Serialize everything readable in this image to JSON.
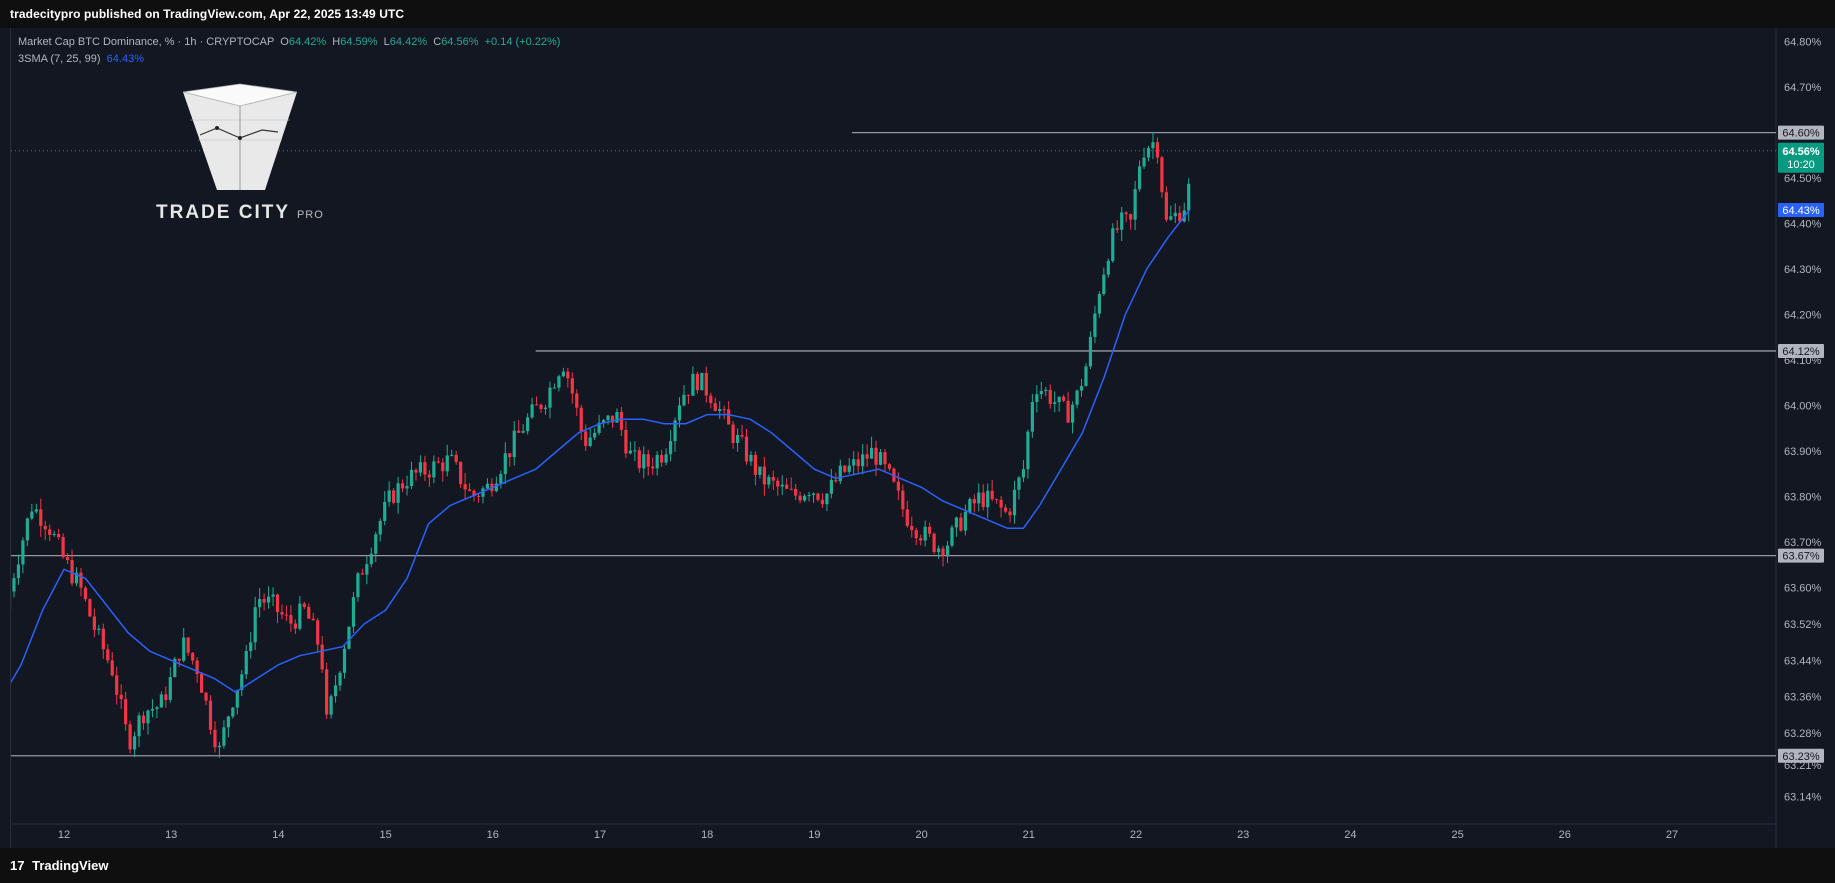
{
  "header": {
    "publisher_line": "tradecitypro published on TradingView.com, Apr 22, 2025 13:49 UTC"
  },
  "legend": {
    "symbol": "Market Cap BTC Dominance, % · 1h · CRYPTOCAP",
    "open_label": "O",
    "open": "64.42%",
    "high_label": "H",
    "high": "64.59%",
    "low_label": "L",
    "low": "64.42%",
    "close_label": "C",
    "close": "64.56%",
    "change": "+0.14 (+0.22%)",
    "indicator": "3SMA (7, 25, 99)",
    "indicator_value": "64.43%"
  },
  "logo": {
    "name": "TRADE CITY",
    "suffix": "PRO"
  },
  "footer": {
    "brand": "TradingView",
    "logo_glyph": "17"
  },
  "colors": {
    "background": "#131722",
    "up": "#22ab94",
    "down": "#f23645",
    "sma": "#2962ff",
    "level_line": "#9598a1",
    "axis_text": "#b2b5be",
    "current_price_bg": "#089981",
    "sma_badge_bg": "#2962ff",
    "level_badge_bg": "#b2b5be"
  },
  "chart_data": {
    "type": "candlestick",
    "timeframe": "1h",
    "y_unit": "%",
    "ylim": [
      63.08,
      64.83
    ],
    "y_ticks": [
      "64.80%",
      "64.70%",
      "64.60%",
      "64.50%",
      "64.40%",
      "64.30%",
      "64.20%",
      "64.10%",
      "64.00%",
      "63.90%",
      "63.80%",
      "63.70%",
      "63.60%",
      "63.52%",
      "63.44%",
      "63.36%",
      "63.28%",
      "63.21%",
      "63.14%"
    ],
    "x_ticks": [
      "12",
      "13",
      "14",
      "15",
      "16",
      "17",
      "18",
      "19",
      "20",
      "21",
      "22",
      "23",
      "24",
      "25",
      "26",
      "27"
    ],
    "x_tick_days": [
      12,
      13,
      14,
      15,
      16,
      17,
      18,
      19,
      20,
      21,
      22,
      23,
      24,
      25,
      26,
      27
    ],
    "horizontal_levels": [
      {
        "value": 64.6,
        "label": "64.60%",
        "from_day": 19.35
      },
      {
        "value": 64.12,
        "label": "64.12%",
        "from_day": 16.4
      },
      {
        "value": 63.67,
        "label": "63.67%",
        "from_day": 11.4
      },
      {
        "value": 63.23,
        "label": "63.23%",
        "from_day": 11.4
      }
    ],
    "current_price": {
      "value": 64.56,
      "label": "64.56%",
      "countdown": "10:20"
    },
    "sma_badge": {
      "value": 64.43,
      "label": "64.43%"
    },
    "price_path": [
      [
        11.45,
        63.55
      ],
      [
        11.55,
        63.65
      ],
      [
        11.7,
        63.78
      ],
      [
        11.85,
        63.74
      ],
      [
        12.0,
        63.66
      ],
      [
        12.15,
        63.6
      ],
      [
        12.3,
        63.5
      ],
      [
        12.45,
        63.42
      ],
      [
        12.6,
        63.26
      ],
      [
        12.75,
        63.33
      ],
      [
        12.9,
        63.34
      ],
      [
        13.0,
        63.4
      ],
      [
        13.1,
        63.48
      ],
      [
        13.25,
        63.42
      ],
      [
        13.35,
        63.32
      ],
      [
        13.45,
        63.24
      ],
      [
        13.55,
        63.34
      ],
      [
        13.7,
        63.44
      ],
      [
        13.8,
        63.58
      ],
      [
        13.95,
        63.56
      ],
      [
        14.1,
        63.52
      ],
      [
        14.25,
        63.55
      ],
      [
        14.4,
        63.46
      ],
      [
        14.45,
        63.3
      ],
      [
        14.6,
        63.46
      ],
      [
        14.75,
        63.62
      ],
      [
        14.9,
        63.72
      ],
      [
        15.05,
        63.8
      ],
      [
        15.2,
        63.84
      ],
      [
        15.4,
        63.86
      ],
      [
        15.6,
        63.88
      ],
      [
        15.8,
        63.8
      ],
      [
        15.95,
        63.82
      ],
      [
        16.1,
        63.88
      ],
      [
        16.3,
        63.96
      ],
      [
        16.5,
        64.02
      ],
      [
        16.65,
        64.1
      ],
      [
        16.72,
        64.05
      ],
      [
        16.85,
        63.92
      ],
      [
        17.0,
        63.95
      ],
      [
        17.15,
        63.98
      ],
      [
        17.3,
        63.88
      ],
      [
        17.45,
        63.87
      ],
      [
        17.6,
        63.9
      ],
      [
        17.75,
        64.02
      ],
      [
        17.9,
        64.06
      ],
      [
        18.05,
        64.02
      ],
      [
        18.2,
        63.95
      ],
      [
        18.35,
        63.9
      ],
      [
        18.5,
        63.84
      ],
      [
        18.65,
        63.82
      ],
      [
        18.8,
        63.8
      ],
      [
        18.95,
        63.82
      ],
      [
        19.1,
        63.8
      ],
      [
        19.25,
        63.85
      ],
      [
        19.45,
        63.88
      ],
      [
        19.55,
        63.9
      ],
      [
        19.7,
        63.84
      ],
      [
        19.85,
        63.76
      ],
      [
        20.0,
        63.72
      ],
      [
        20.15,
        63.69
      ],
      [
        20.25,
        63.7
      ],
      [
        20.4,
        63.76
      ],
      [
        20.55,
        63.8
      ],
      [
        20.7,
        63.78
      ],
      [
        20.8,
        63.76
      ],
      [
        20.95,
        63.86
      ],
      [
        21.05,
        64.05
      ],
      [
        21.2,
        64.02
      ],
      [
        21.35,
        63.98
      ],
      [
        21.45,
        64.02
      ],
      [
        21.55,
        64.1
      ],
      [
        21.65,
        64.25
      ],
      [
        21.75,
        64.35
      ],
      [
        21.85,
        64.4
      ],
      [
        21.95,
        64.4
      ],
      [
        22.05,
        64.56
      ],
      [
        22.15,
        64.58
      ],
      [
        22.2,
        64.57
      ],
      [
        22.28,
        64.4
      ],
      [
        22.38,
        64.42
      ],
      [
        22.48,
        64.45
      ],
      [
        22.53,
        64.56
      ]
    ],
    "sma_path": [
      [
        11.45,
        63.37
      ],
      [
        11.6,
        63.43
      ],
      [
        11.8,
        63.55
      ],
      [
        12.0,
        63.64
      ],
      [
        12.2,
        63.62
      ],
      [
        12.4,
        63.56
      ],
      [
        12.6,
        63.5
      ],
      [
        12.8,
        63.46
      ],
      [
        13.0,
        63.44
      ],
      [
        13.2,
        63.42
      ],
      [
        13.4,
        63.4
      ],
      [
        13.6,
        63.37
      ],
      [
        13.8,
        63.4
      ],
      [
        14.0,
        63.43
      ],
      [
        14.2,
        63.45
      ],
      [
        14.4,
        63.46
      ],
      [
        14.6,
        63.47
      ],
      [
        14.8,
        63.52
      ],
      [
        15.0,
        63.55
      ],
      [
        15.2,
        63.62
      ],
      [
        15.4,
        63.74
      ],
      [
        15.6,
        63.78
      ],
      [
        15.8,
        63.8
      ],
      [
        16.0,
        63.82
      ],
      [
        16.2,
        63.84
      ],
      [
        16.4,
        63.86
      ],
      [
        16.6,
        63.9
      ],
      [
        16.8,
        63.94
      ],
      [
        17.0,
        63.96
      ],
      [
        17.2,
        63.97
      ],
      [
        17.4,
        63.97
      ],
      [
        17.6,
        63.96
      ],
      [
        17.8,
        63.96
      ],
      [
        18.0,
        63.98
      ],
      [
        18.2,
        63.98
      ],
      [
        18.4,
        63.97
      ],
      [
        18.6,
        63.94
      ],
      [
        18.8,
        63.9
      ],
      [
        19.0,
        63.86
      ],
      [
        19.2,
        63.84
      ],
      [
        19.4,
        63.85
      ],
      [
        19.6,
        63.86
      ],
      [
        19.8,
        63.84
      ],
      [
        20.0,
        63.82
      ],
      [
        20.2,
        63.79
      ],
      [
        20.4,
        63.77
      ],
      [
        20.6,
        63.75
      ],
      [
        20.8,
        63.73
      ],
      [
        20.95,
        63.73
      ],
      [
        21.1,
        63.78
      ],
      [
        21.3,
        63.86
      ],
      [
        21.5,
        63.94
      ],
      [
        21.7,
        64.06
      ],
      [
        21.9,
        64.2
      ],
      [
        22.1,
        64.3
      ],
      [
        22.3,
        64.37
      ],
      [
        22.5,
        64.43
      ]
    ]
  }
}
